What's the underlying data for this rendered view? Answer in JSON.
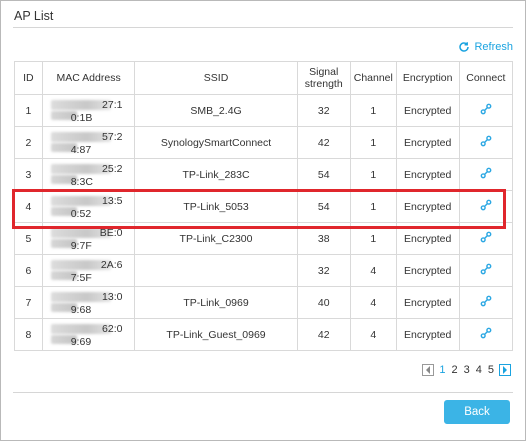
{
  "panel": {
    "title": "AP List"
  },
  "toolbar": {
    "refresh_label": "Refresh"
  },
  "table": {
    "headers": {
      "id": "ID",
      "mac": "MAC Address",
      "ssid": "SSID",
      "signal_line1": "Signal",
      "signal_line2": "strength",
      "channel": "Channel",
      "encryption": "Encryption",
      "connect": "Connect"
    },
    "rows": [
      {
        "id": "1",
        "mac_top": "27:1",
        "mac_bottom": "0:1B",
        "ssid": "SMB_2.4G",
        "signal": "32",
        "channel": "1",
        "encryption": "Encrypted",
        "connect_icon": "link-icon"
      },
      {
        "id": "2",
        "mac_top": "57:2",
        "mac_bottom": "4:87",
        "ssid": "SynologySmartConnect",
        "signal": "42",
        "channel": "1",
        "encryption": "Encrypted",
        "connect_icon": "link-icon"
      },
      {
        "id": "3",
        "mac_top": "25:2",
        "mac_bottom": "8:3C",
        "ssid": "TP-Link_283C",
        "signal": "54",
        "channel": "1",
        "encryption": "Encrypted",
        "connect_icon": "link-icon"
      },
      {
        "id": "4",
        "mac_top": "13:5",
        "mac_bottom": "0:52",
        "ssid": "TP-Link_5053",
        "signal": "54",
        "channel": "1",
        "encryption": "Encrypted",
        "connect_icon": "link-icon"
      },
      {
        "id": "5",
        "mac_top": "BE:0",
        "mac_bottom": "9:7F",
        "ssid": "TP-Link_C2300",
        "signal": "38",
        "channel": "1",
        "encryption": "Encrypted",
        "connect_icon": "link-icon"
      },
      {
        "id": "6",
        "mac_top": "2A:6",
        "mac_bottom": "7:5F",
        "ssid": "",
        "signal": "32",
        "channel": "4",
        "encryption": "Encrypted",
        "connect_icon": "link-icon"
      },
      {
        "id": "7",
        "mac_top": "13:0",
        "mac_bottom": "9:68",
        "ssid": "TP-Link_0969",
        "signal": "40",
        "channel": "4",
        "encryption": "Encrypted",
        "connect_icon": "link-icon"
      },
      {
        "id": "8",
        "mac_top": "62:0",
        "mac_bottom": "9:69",
        "ssid": "TP-Link_Guest_0969",
        "signal": "42",
        "channel": "4",
        "encryption": "Encrypted",
        "connect_icon": "link-icon"
      }
    ]
  },
  "pagination": {
    "pages": [
      "1",
      "2",
      "3",
      "4",
      "5"
    ],
    "current": "1"
  },
  "footer": {
    "back_label": "Back"
  },
  "colors": {
    "accent": "#1aa3e0",
    "highlight": "#e0262c",
    "button": "#3bb4e6"
  }
}
